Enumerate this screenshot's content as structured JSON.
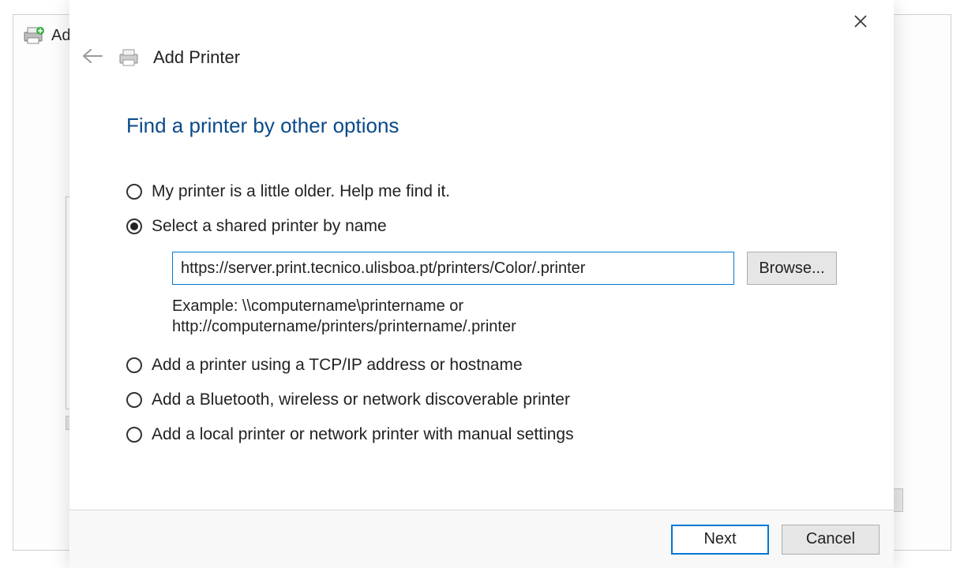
{
  "backdrop": {
    "title_fragment": "Ad"
  },
  "dialog": {
    "title": "Add Printer",
    "heading": "Find a printer by other options",
    "options": {
      "older": "My printer is a little older. Help me find it.",
      "shared": "Select a shared printer by name",
      "tcpip": "Add a printer using a TCP/IP address or hostname",
      "bluetooth": "Add a Bluetooth, wireless or network discoverable printer",
      "local": "Add a local printer or network printer with manual settings"
    },
    "selected_option": "shared",
    "url_value": "https://server.print.tecnico.ulisboa.pt/printers/Color/.printer",
    "example_line1": "Example: \\\\computername\\printername or",
    "example_line2": "http://computername/printers/printername/.printer",
    "browse_label": "Browse...",
    "next_label": "Next",
    "cancel_label": "Cancel"
  }
}
